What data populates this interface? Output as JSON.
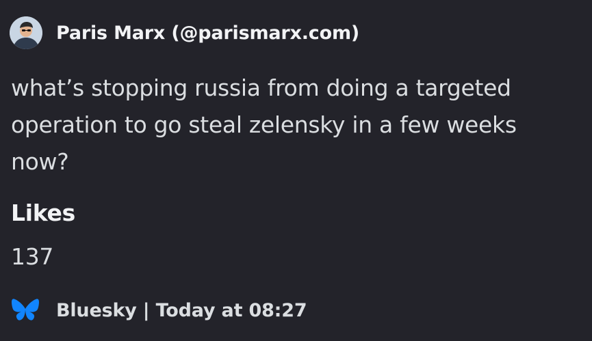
{
  "embed": {
    "author": {
      "name": "Paris Marx (@parismarx.com)",
      "avatar_icon": "profile-photo"
    },
    "post_text": "what’s stopping russia from doing a targeted operation to go steal zelensky in a few weeks now?",
    "fields": [
      {
        "name": "Likes",
        "value": "137"
      }
    ],
    "footer": {
      "icon": "bluesky-butterfly-icon",
      "text": "Bluesky | Today at 08:27"
    }
  },
  "colors": {
    "background": "#23232a",
    "text_primary": "#f2f3f5",
    "text_secondary": "#dbdee1",
    "bluesky_blue": "#1185fe"
  }
}
